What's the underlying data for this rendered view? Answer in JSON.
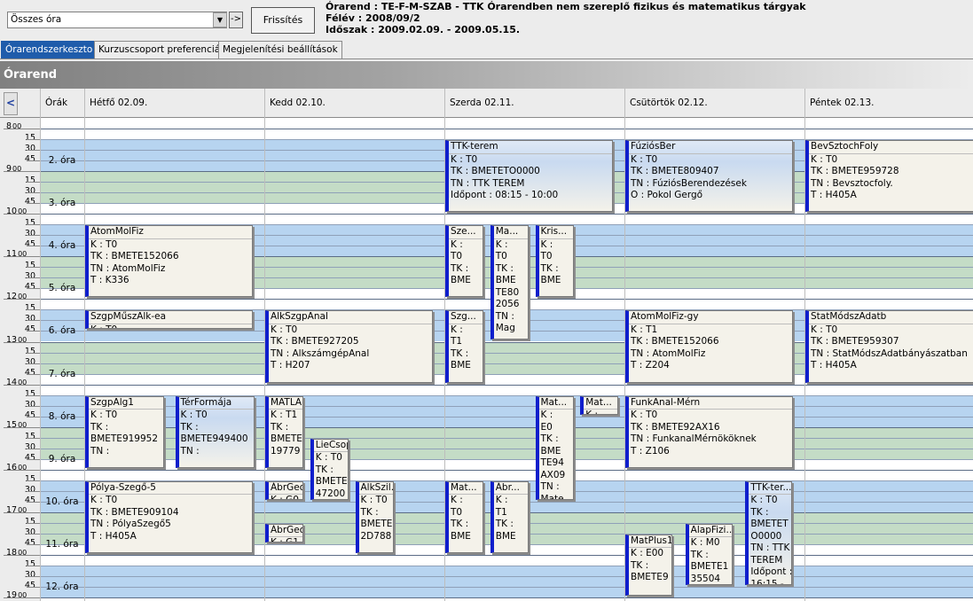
{
  "toolbar": {
    "combo_value": "Összes óra",
    "go_label": "->",
    "refresh_label": "Frissítés"
  },
  "header": {
    "line1": "Órarend : TE-F-M-SZAB - TTK Órarendben nem szereplő fizikus és matematikus tárgyak",
    "line2": "Félév : 2008/09/2",
    "line3": "Időszak : 2009.02.09. - 2009.05.15."
  },
  "tabs": [
    {
      "label": "Órarendszerkeszto",
      "active": true
    },
    {
      "label": "Kurzuscsoport preferenciák",
      "active": false
    },
    {
      "label": "Megjelenítési beállítások",
      "active": false
    }
  ],
  "panel_title": "Órarend",
  "columns": {
    "nav": "<",
    "orak": "Órák",
    "days": [
      "Hétfő  02.09.",
      "Kedd  02.10.",
      "Szerda  02.11.",
      "Csütörtök  02.12.",
      "Péntek  02.13."
    ]
  },
  "time_labels": [
    {
      "h": "8",
      "q": [
        "15",
        "30",
        "45"
      ]
    },
    {
      "h": "9",
      "q": [
        "15",
        "30",
        "45"
      ]
    },
    {
      "h": "10",
      "q": [
        "15",
        "30",
        "45"
      ]
    },
    {
      "h": "11",
      "q": [
        "15",
        "30",
        "45"
      ]
    },
    {
      "h": "12",
      "q": [
        "15",
        "30",
        "45"
      ]
    },
    {
      "h": "13",
      "q": [
        "15",
        "30",
        "45"
      ]
    },
    {
      "h": "14",
      "q": [
        "15",
        "30",
        "45"
      ]
    },
    {
      "h": "15",
      "q": [
        "15",
        "30",
        "45"
      ]
    },
    {
      "h": "16",
      "q": [
        "15",
        "30",
        "45"
      ]
    },
    {
      "h": "17",
      "q": [
        "15",
        "30",
        "45"
      ]
    },
    {
      "h": "18",
      "q": [
        "15",
        "30",
        "45"
      ]
    },
    {
      "h": "19",
      "q": []
    }
  ],
  "minute_suffix": "00",
  "periods": [
    "2. óra",
    "3. óra",
    "4. óra",
    "5. óra",
    "6. óra",
    "7. óra",
    "8. óra",
    "9. óra",
    "10. óra",
    "11. óra",
    "12. óra"
  ],
  "events": [
    {
      "day": 2,
      "start": "8:15",
      "end": "10:00",
      "sub": 0,
      "subs": 1,
      "width": 0.93,
      "hi": true,
      "title": "TTK-terem",
      "lines": [
        "K : T0",
        "TK : BMETETO0000",
        "TN : TTK TEREM",
        "Időpont : 08:15 - 10:00"
      ]
    },
    {
      "day": 3,
      "start": "8:15",
      "end": "10:00",
      "sub": 0,
      "subs": 1,
      "width": 0.93,
      "hi": true,
      "title": "FúziósBer",
      "lines": [
        "K : T0",
        "TK : BMETE809407",
        "TN : FúziósBerendezések",
        "O : Pokol Gergő"
      ]
    },
    {
      "day": 4,
      "start": "8:15",
      "end": "10:00",
      "sub": 0,
      "subs": 1,
      "width": 1.0,
      "hi": false,
      "title": "BevSztochFoly",
      "lines": [
        "K : T0",
        "TK : BMETE959728",
        "TN : Bevsztocfoly.",
        "T : H405A"
      ]
    },
    {
      "day": 0,
      "start": "10:15",
      "end": "12:00",
      "sub": 0,
      "subs": 1,
      "width": 0.93,
      "hi": false,
      "title": "AtomMolFiz",
      "lines": [
        "K : T0",
        "TK : BMETE152066",
        "TN : AtomMolFiz",
        "T : K336"
      ]
    },
    {
      "day": 2,
      "start": "10:15",
      "end": "12:00",
      "sub": 0,
      "subs": 4,
      "width": 0.85,
      "hi": false,
      "title": "Sze...",
      "lines": [
        "K :",
        "T0",
        "TK :",
        "BME"
      ]
    },
    {
      "day": 2,
      "start": "10:15",
      "end": "13:00",
      "sub": 1,
      "subs": 4,
      "width": 0.85,
      "hi": false,
      "title": "Ma...",
      "lines": [
        "K :",
        "T0",
        "TK :",
        "BME",
        "TE80",
        "2056",
        "TN :",
        "Mag"
      ]
    },
    {
      "day": 2,
      "start": "10:15",
      "end": "12:00",
      "sub": 2,
      "subs": 4,
      "width": 0.85,
      "hi": false,
      "title": "Kris...",
      "lines": [
        "K :",
        "T0",
        "TK :",
        "BME"
      ]
    },
    {
      "day": 0,
      "start": "12:15",
      "end": "12:45",
      "sub": 0,
      "subs": 1,
      "width": 0.93,
      "hi": false,
      "title": "SzgpMűszAlk-ea",
      "lines": [
        "K : T0"
      ]
    },
    {
      "day": 1,
      "start": "12:15",
      "end": "14:00",
      "sub": 0,
      "subs": 1,
      "width": 0.93,
      "hi": false,
      "title": "AlkSzgpAnal",
      "lines": [
        "K : T0",
        "TK : BMETE927205",
        "TN : AlkszámgépAnal",
        "T : H207"
      ]
    },
    {
      "day": 2,
      "start": "12:15",
      "end": "14:00",
      "sub": 0,
      "subs": 4,
      "width": 0.85,
      "hi": false,
      "title": "Szg...",
      "lines": [
        "K :",
        "T1",
        "TK :",
        "BME"
      ]
    },
    {
      "day": 3,
      "start": "12:15",
      "end": "14:00",
      "sub": 0,
      "subs": 1,
      "width": 0.93,
      "hi": false,
      "title": "AtomMolFiz-gy",
      "lines": [
        "K : T1",
        "TK : BMETE152066",
        "TN : AtomMolFiz",
        "T : Z204"
      ]
    },
    {
      "day": 4,
      "start": "12:15",
      "end": "14:00",
      "sub": 0,
      "subs": 1,
      "width": 1.0,
      "hi": false,
      "title": "StatMódszAdatb",
      "lines": [
        "K : T0",
        "TK : BMETE959307",
        "TN : StatMódszAdatbányászatban",
        "T : H405A"
      ]
    },
    {
      "day": 0,
      "start": "14:15",
      "end": "16:00",
      "sub": 0,
      "subs": 2,
      "width": 0.88,
      "hi": false,
      "title": "SzgpAlg1",
      "lines": [
        "K : T0",
        "TK :",
        "BMETE919952",
        "TN :"
      ]
    },
    {
      "day": 0,
      "start": "14:15",
      "end": "16:00",
      "sub": 1,
      "subs": 2,
      "width": 0.88,
      "hi": true,
      "title": "TérFormája",
      "lines": [
        "K : T0",
        "TK :",
        "BMETE949400",
        "TN :"
      ]
    },
    {
      "day": 1,
      "start": "14:15",
      "end": "16:00",
      "sub": 0,
      "subs": 4,
      "width": 0.85,
      "hi": false,
      "title": "MATLA...",
      "lines": [
        "K : T1",
        "TK :",
        "BMETE1",
        "19779"
      ]
    },
    {
      "day": 1,
      "start": "15:15",
      "end": "16:45",
      "sub": 1,
      "subs": 4,
      "width": 0.85,
      "hi": false,
      "title": "LieCsop",
      "lines": [
        "K : T0",
        "TK :",
        "BMETE9",
        "47200"
      ]
    },
    {
      "day": 2,
      "start": "14:15",
      "end": "16:45",
      "sub": 2,
      "subs": 4,
      "width": 0.85,
      "hi": false,
      "title": "Mat...",
      "lines": [
        "K :",
        "E0",
        "TK :",
        "BME",
        "TE94",
        "AX09",
        "TN :",
        "Mate"
      ]
    },
    {
      "day": 2,
      "start": "14:15",
      "end": "14:45",
      "sub": 3,
      "subs": 4,
      "width": 0.85,
      "hi": false,
      "title": "Mat...",
      "lines": [
        "K :"
      ]
    },
    {
      "day": 3,
      "start": "14:15",
      "end": "16:00",
      "sub": 0,
      "subs": 1,
      "width": 0.93,
      "hi": false,
      "title": "FunkAnal-Mérn",
      "lines": [
        "K : T0",
        "TK : BMETE92AX16",
        "TN : FunkanalMérnököknek",
        "T : Z106"
      ]
    },
    {
      "day": 0,
      "start": "16:15",
      "end": "18:00",
      "sub": 0,
      "subs": 1,
      "width": 0.93,
      "hi": false,
      "title": "Pólya-Szegő-5",
      "lines": [
        "K : T0",
        "TK : BMETE909104",
        "TN : PólyaSzegő5",
        "T : H405A"
      ]
    },
    {
      "day": 1,
      "start": "16:15",
      "end": "16:45",
      "sub": 0,
      "subs": 4,
      "width": 0.85,
      "hi": false,
      "title": "ÁbrGeo...",
      "lines": [
        "K : G0"
      ]
    },
    {
      "day": 1,
      "start": "17:15",
      "end": "17:45",
      "sub": 0,
      "subs": 4,
      "width": 0.85,
      "hi": false,
      "title": "ÁbrGeo...",
      "lines": [
        "K : G1"
      ]
    },
    {
      "day": 1,
      "start": "16:15",
      "end": "18:00",
      "sub": 2,
      "subs": 4,
      "width": 0.85,
      "hi": false,
      "title": "AlkSzil...",
      "lines": [
        "K : T0",
        "TK :",
        "BMETE1",
        "2D788"
      ]
    },
    {
      "day": 2,
      "start": "16:15",
      "end": "18:00",
      "sub": 0,
      "subs": 4,
      "width": 0.85,
      "hi": false,
      "title": "Mat...",
      "lines": [
        "K :",
        "T0",
        "TK :",
        "BME"
      ]
    },
    {
      "day": 2,
      "start": "16:15",
      "end": "18:00",
      "sub": 1,
      "subs": 4,
      "width": 0.85,
      "hi": false,
      "title": "Ábr...",
      "lines": [
        "K :",
        "T1",
        "TK :",
        "BME"
      ]
    },
    {
      "day": 3,
      "start": "17:30",
      "end": "19:00",
      "sub": 0,
      "subs": 3,
      "width": 0.78,
      "hi": false,
      "title": "MatPlus1",
      "lines": [
        "K : E00",
        "TK :",
        "BMETE9"
      ]
    },
    {
      "day": 3,
      "start": "17:15",
      "end": "18:45",
      "sub": 1,
      "subs": 3,
      "width": 0.78,
      "hi": false,
      "title": "AlapFizi...",
      "lines": [
        "K : M0",
        "TK :",
        "BMETE1",
        "35504"
      ]
    },
    {
      "day": 3,
      "start": "16:15",
      "end": "18:45",
      "sub": 2,
      "subs": 3,
      "width": 0.78,
      "hi": true,
      "title": "TTK-ter...",
      "lines": [
        "K : T0",
        "TK :",
        "BMETET",
        "O0000",
        "TN : TTK",
        "TEREM",
        "Időpont :",
        "16:15 -"
      ]
    }
  ]
}
